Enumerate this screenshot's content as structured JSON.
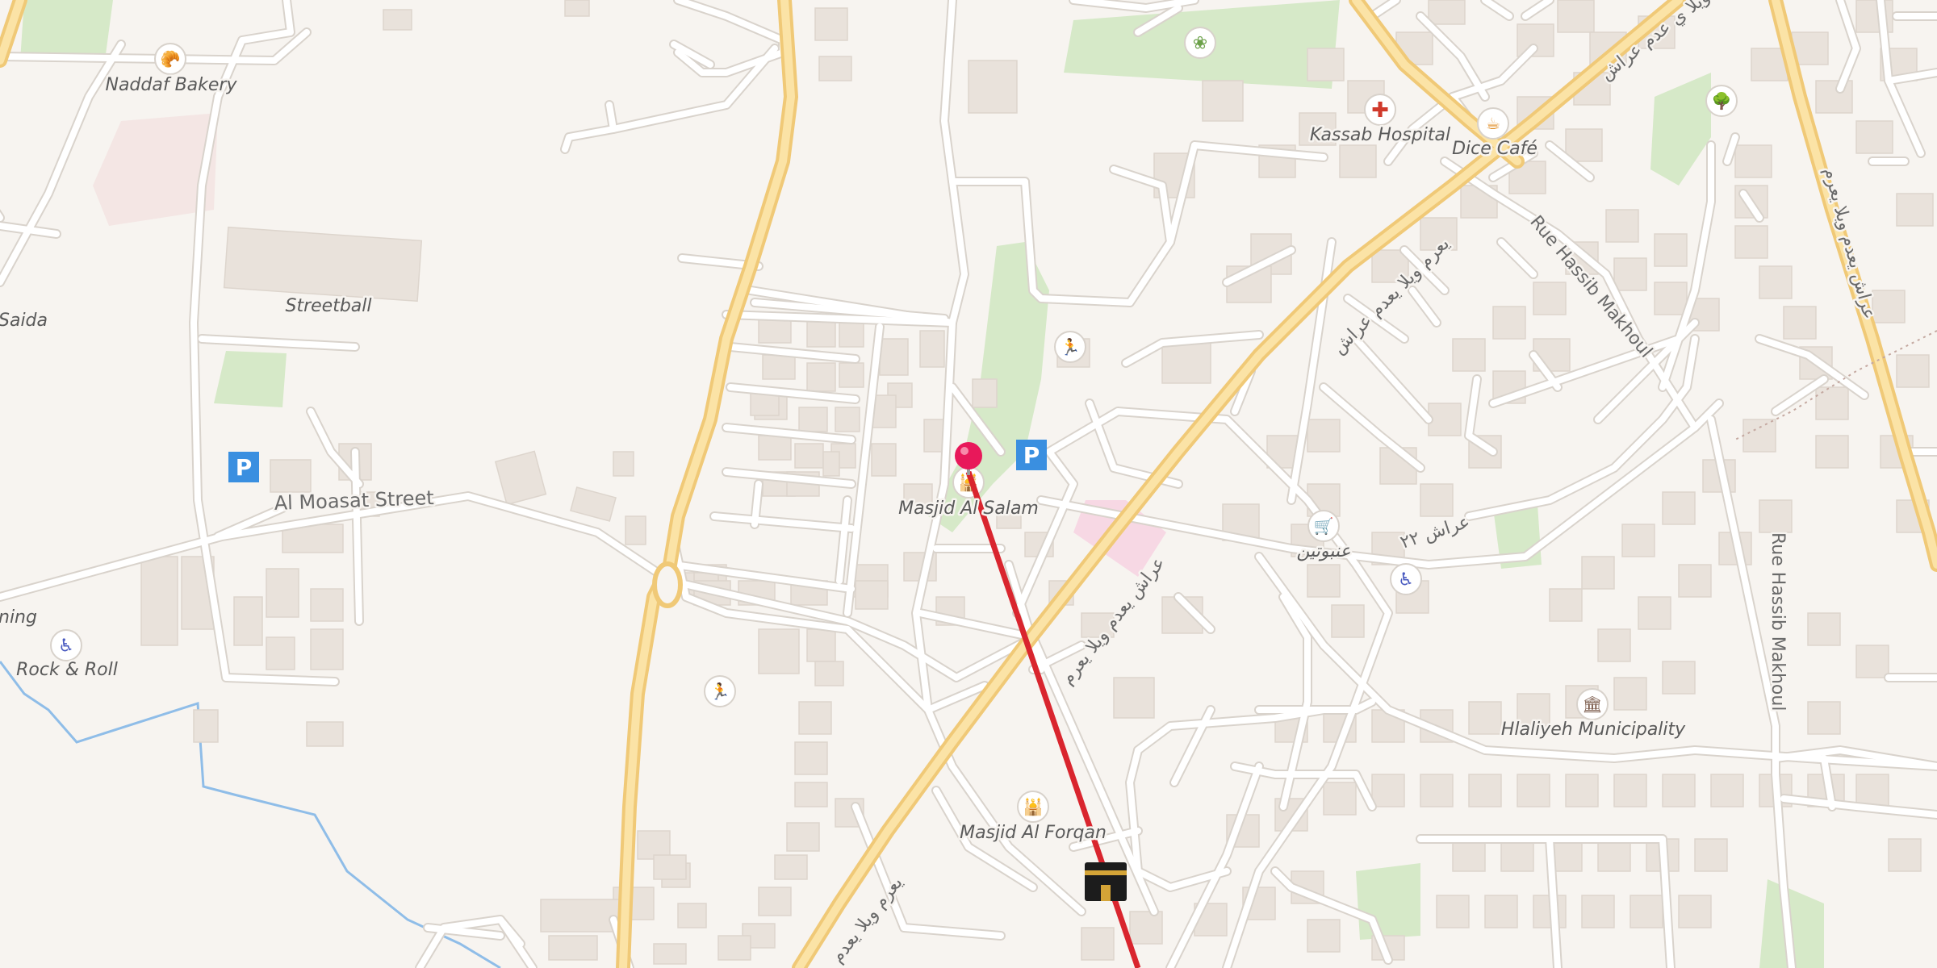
{
  "map": {
    "places": {
      "naddaf_bakery": "Naddaf Bakery",
      "streetball": "Streetball",
      "saida": "Saida",
      "ning": "ning",
      "rock_and_roll": "Rock & Roll",
      "masjid_al_salam": "Masjid Al Salam",
      "masjid_al_forqan": "Masjid Al Forqan",
      "kassab_hospital": "Kassab Hospital",
      "dice_cafe": "Dice Café",
      "hlaliyeh_municipality": "Hlaliyeh Municipality",
      "supermarket_ar": "عنبوتين"
    },
    "streets": {
      "al_moasat": "Al Moasat Street",
      "rue_hassib_makhoul_1": "Rue Hassib Makhoul",
      "rue_hassib_makhoul_2": "Rue Hassib Makhoul",
      "arabic_main_1": "يعرم ويلا ي عدم عراش",
      "arabic_main_2": "يعرم ويلا يعدم عراش",
      "arabic_main_3": "عراش يعدم ويلا يعرم",
      "arabic_main_4": "يعرم ويلا يعدم",
      "arabic_right": "عراش يعدم ويلا يعرم",
      "arabic_22": "عراش ٢٢"
    },
    "icons": {
      "bakery": "bakery-icon",
      "parking": "parking-icon",
      "disabled": "wheelchair-icon",
      "mosque": "mosque-icon",
      "hospital": "hospital-icon",
      "cafe": "cafe-icon",
      "supermarket": "shopping-cart-icon",
      "municipality": "municipality-icon",
      "sports": "sports-icon",
      "garden": "garden-icon",
      "park": "tree-icon",
      "kaaba": "kaaba-icon",
      "pin": "location-pin-icon"
    },
    "colors": {
      "background": "#f7f4f0",
      "major_road": "#f0c977",
      "qibla_line": "#d9252e",
      "pin": "#e8185a",
      "parking": "#3a8fe0",
      "park": "#d6e9c8",
      "water": "#8fbde8"
    }
  }
}
